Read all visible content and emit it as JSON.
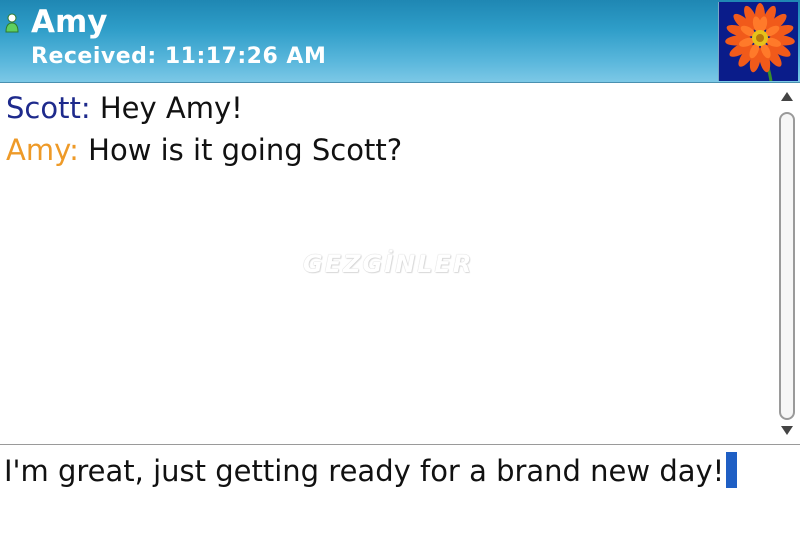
{
  "header": {
    "contact_name": "Amy",
    "received_line": "Received: 11:17:26 AM",
    "presence_icon": "person-online-icon",
    "avatar_icon": "flower-avatar"
  },
  "conversation": {
    "messages": [
      {
        "sender": "Scott:",
        "text": "Hey Amy!"
      },
      {
        "sender": "Amy:",
        "text": "How is it going Scott?"
      }
    ],
    "watermark": "GEZGİNLER"
  },
  "compose": {
    "value": "I'm great, just getting ready for a brand new day!"
  },
  "colors": {
    "header_gradient_top": "#1f87b3",
    "header_gradient_bottom": "#7cc8e6",
    "sender_scott": "#1e2a8c",
    "sender_amy": "#ee9a28",
    "caret": "#1f5fc4"
  }
}
